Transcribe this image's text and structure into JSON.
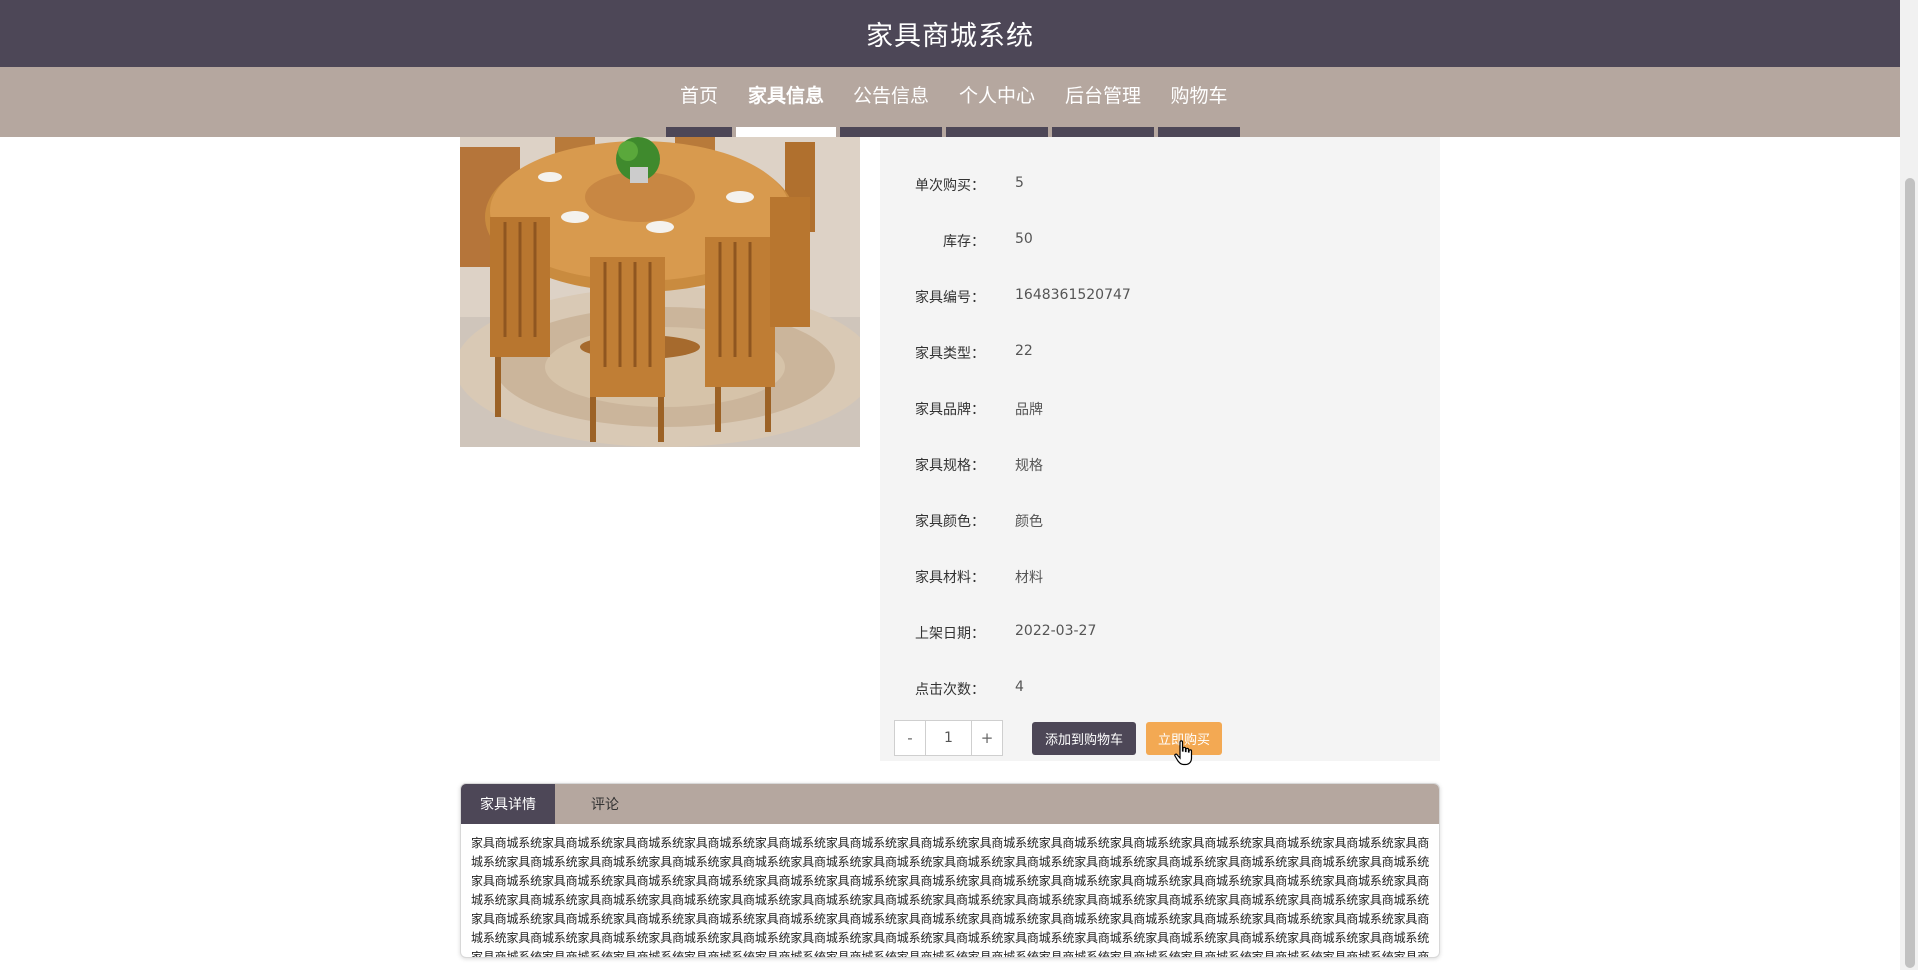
{
  "header": {
    "title": "家具商城系统"
  },
  "nav": {
    "items": [
      {
        "label": "首页"
      },
      {
        "label": "家具信息"
      },
      {
        "label": "公告信息"
      },
      {
        "label": "个人中心"
      },
      {
        "label": "后台管理"
      },
      {
        "label": "购物车"
      }
    ],
    "active": "家具信息"
  },
  "product": {
    "details": [
      {
        "key": "单次购买：",
        "value": "5"
      },
      {
        "key": "库存：",
        "value": "50"
      },
      {
        "key": "家具编号：",
        "value": "1648361520747"
      },
      {
        "key": "家具类型：",
        "value": "22"
      },
      {
        "key": "家具品牌：",
        "value": "品牌"
      },
      {
        "key": "家具规格：",
        "value": "规格"
      },
      {
        "key": "家具颜色：",
        "value": "颜色"
      },
      {
        "key": "家具材料：",
        "value": "材料"
      },
      {
        "key": "上架日期：",
        "value": "2022-03-27"
      },
      {
        "key": "点击次数：",
        "value": "4"
      }
    ],
    "quantity": {
      "minus_label": "-",
      "value": "1",
      "plus_label": "+"
    },
    "add_to_cart_label": "添加到购物车",
    "buy_now_label": "立即购买"
  },
  "tabs": {
    "items": [
      {
        "label": "家具详情"
      },
      {
        "label": "评论"
      }
    ],
    "active": "家具详情",
    "content": "家具商城系统家具商城系统家具商城系统家具商城系统家具商城系统家具商城系统家具商城系统家具商城系统家具商城系统家具商城系统家具商城系统家具商城系统家具商城系统家具商城系统家具商城系统家具商城系统家具商城系统家具商城系统家具商城系统家具商城系统家具商城系统家具商城系统家具商城系统家具商城系统家具商城系统家具商城系统家具商城系统家具商城系统家具商城系统家具商城系统家具商城系统家具商城系统家具商城系统家具商城系统家具商城系统家具商城系统家具商城系统家具商城系统家具商城系统家具商城系统家具商城系统家具商城系统家具商城系统家具商城系统家具商城系统家具商城系统家具商城系统家具商城系统家具商城系统家具商城系统家具商城系统家具商城系统家具商城系统家具商城系统家具商城系统家具商城系统家具商城系统家具商城系统家具商城系统家具商城系统家具商城系统家具商城系统家具商城系统家具商城系统家具商城系统家具商城系统家具商城系统家具商城系统家具商城系统家具商城系统家具商城系统家具商城系统家具商城系统家具商城系统家具商城系统家具商城系统家具商城系统家具商城系统家具商城系统家具商城系统家具商城系统家具商城系统家具商城系统家具商城系统家具商城系统家具商城系统家具商城系统家具商城系统家具商城系统家具商城系统家具商城系统家具商城系统家具商城系统家具商城系统家具商城系统家具商城系统家具商城系统家具商城系统家具商城系统家具商城系统家具商城系统家具商城系统家具商城系统家具商城系统家具商城系统家具商城系统家具商城系统"
  },
  "colors": {
    "header_bg": "#4d4757",
    "nav_bg": "#b5a79f",
    "panel_bg": "#f4f4f4",
    "buy_button": "#f3a953",
    "cart_button": "#4d4757"
  },
  "icons": {
    "cursor": "hand-pointer-icon"
  }
}
